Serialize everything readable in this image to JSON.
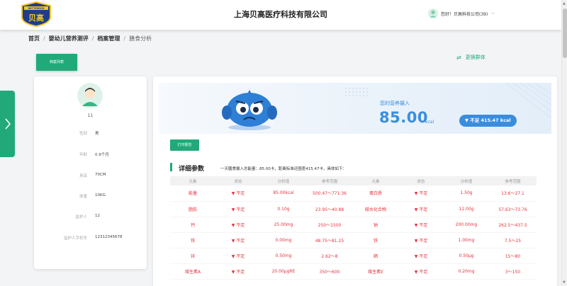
{
  "header": {
    "logo_text": "BETTERBOB",
    "logo_cn": "贝高",
    "company_title": "上海贝高医疗科技有限公司",
    "user_greeting": "您好！贝高科技公司(39)"
  },
  "breadcrumb": [
    "首页",
    "婴幼儿营养测评",
    "档案管理",
    "膳食分析"
  ],
  "buttons": {
    "archive_list": "档案列表",
    "switch_group": "更换群体",
    "print_report": "打印报告"
  },
  "profile": {
    "name": "11",
    "fields": [
      {
        "label": "性别",
        "value": "男"
      },
      {
        "label": "年龄",
        "value": "0.9个月"
      },
      {
        "label": "身高",
        "value": "70CM"
      },
      {
        "label": "体重",
        "value": "10KG"
      },
      {
        "label": "监护人",
        "value": "12"
      },
      {
        "label": "监护人手机号",
        "value": "12312345678"
      }
    ]
  },
  "summary": {
    "label": "您的营养摄入",
    "value": "85.00",
    "unit": "kcal",
    "deficit": "▼ 不足 415.47 kcal"
  },
  "details": {
    "title": "详细参数",
    "description": "一天膳食摄入总能量：85.00卡，距离标准还围差415.47卡，具体如下：",
    "headers": [
      "元素",
      "状态",
      "分析值",
      "参考范围",
      "元素",
      "状态",
      "分析值",
      "参考范围"
    ],
    "rows": [
      [
        "能量",
        "▼ 不足",
        "85.00kcal",
        "500.47～771.36",
        "蛋白质",
        "▼ 不足",
        "1.50g",
        "13.6～27.1"
      ],
      [
        "脂肪",
        "▼ 不足",
        "0.10g",
        "23.95～40.88",
        "碳水化合物",
        "▼ 不足",
        "12.00g",
        "57.63～73.76"
      ],
      [
        "钙",
        "▼ 不足",
        "25.00mg",
        "250～1500",
        "钠",
        "▼ 不足",
        "200.00mg",
        "262.5～437.5"
      ],
      [
        "铁",
        "▼ 不足",
        "0.00mg",
        "48.75～81.25",
        "铁",
        "▼ 不足",
        "1.00mg",
        "7.5～25"
      ],
      [
        "锌",
        "▼ 不足",
        "0.50mg",
        "2.62～8",
        "硒",
        "▼ 不足",
        "0.50μg",
        "15～80"
      ],
      [
        "维生素A",
        "▼ 不足",
        "20.00μgRE",
        "350～600",
        "维生素E",
        "▼ 不足",
        "0.20mg",
        "3～150"
      ]
    ]
  },
  "colors": {
    "accent_green": "#22a97a",
    "accent_blue": "#3a8dde",
    "deficit_red": "#e5323e"
  },
  "icons": {
    "side_tab": "chevron-right-icon",
    "switch": "swap-arrows-icon",
    "user_menu": "chevron-down-icon"
  }
}
